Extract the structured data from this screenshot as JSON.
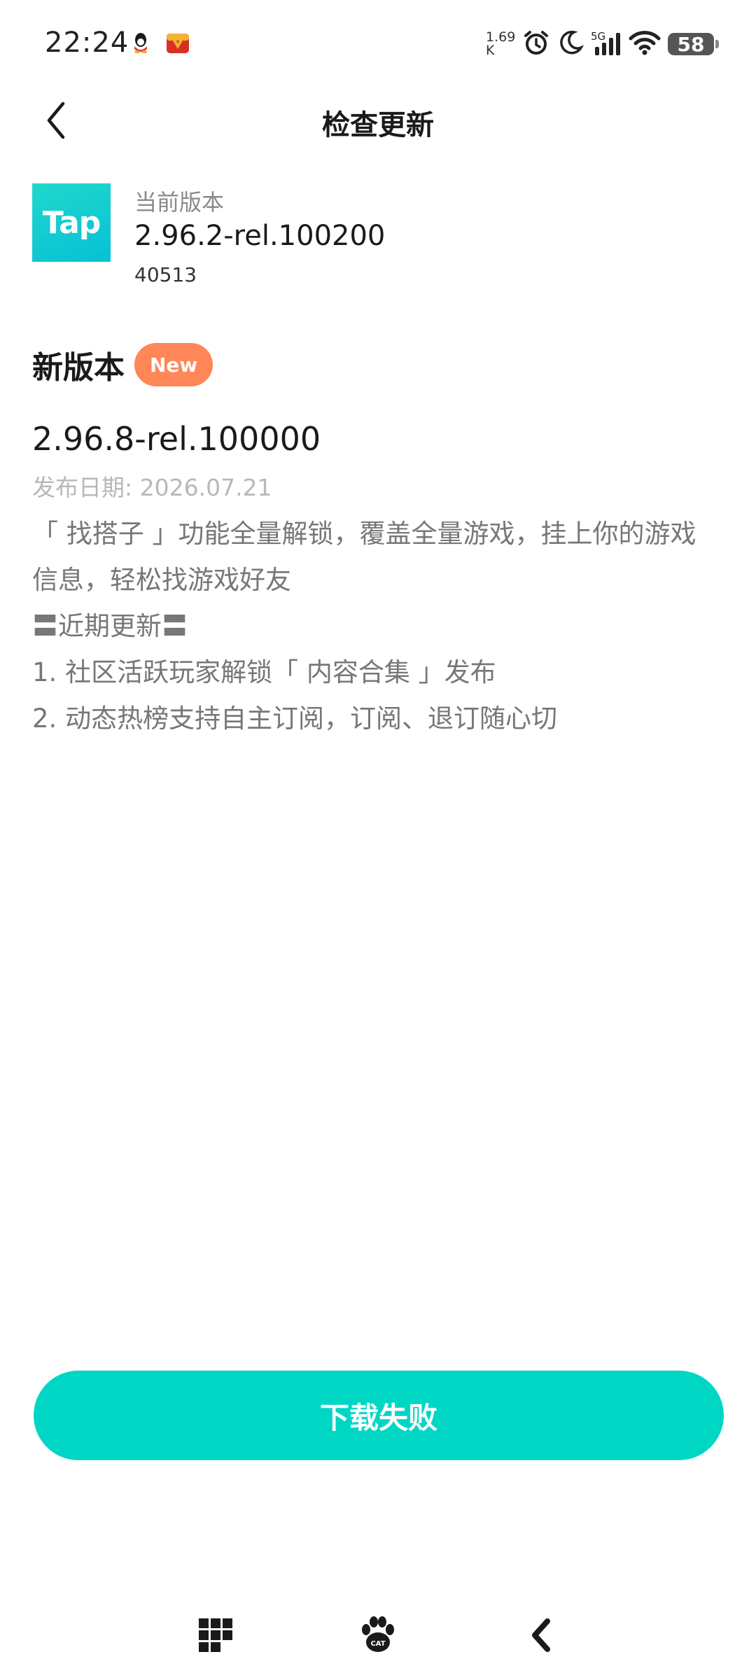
{
  "status_bar": {
    "time": "22:24",
    "net_speed_value": "1.69",
    "net_speed_unit": "K",
    "network_type": "5G",
    "battery_level": "58",
    "icons": [
      "qq-icon",
      "gift-icon",
      "alarm-icon",
      "moon-icon",
      "signal-icon",
      "wifi-icon",
      "battery-icon"
    ]
  },
  "header": {
    "title": "检查更新"
  },
  "current": {
    "logo_text": "Tap",
    "label": "当前版本",
    "version": "2.96.2-rel.100200",
    "build": "40513"
  },
  "new_version": {
    "title": "新版本",
    "badge": "New",
    "version": "2.96.8-rel.100000",
    "release_date": "发布日期: 2026.07.21",
    "notes": [
      "「 找搭子 」功能全量解锁，覆盖全量游戏，挂上你的游戏",
      "信息，轻松找游戏好友",
      "〓近期更新〓",
      "1. 社区活跃玩家解锁「 内容合集 」发布",
      "2. 动态热榜支持自主订阅，订阅、退订随心切"
    ]
  },
  "action": {
    "button_label": "下载失败"
  },
  "nav_bar": {
    "cat_label": "CAT"
  },
  "colors": {
    "accent": "#00d6c4",
    "badge": "#ff8656",
    "muted_text": "#777777",
    "date_text": "#b8b8b8"
  }
}
